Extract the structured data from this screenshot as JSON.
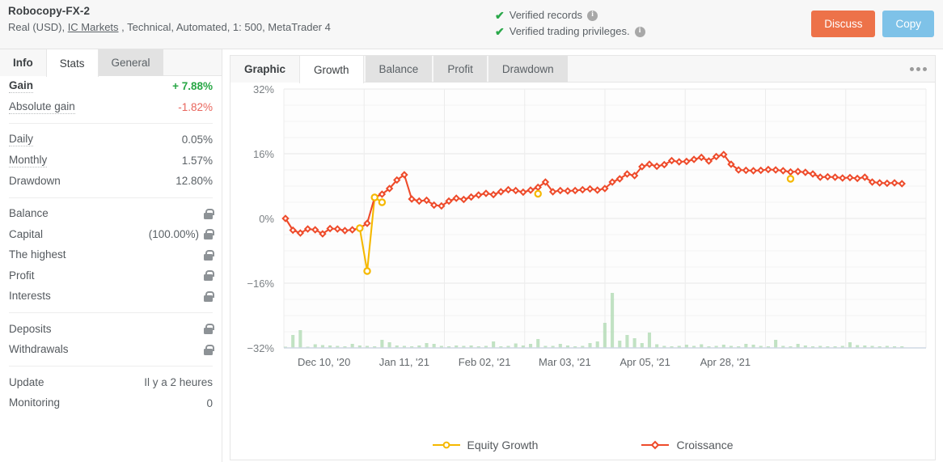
{
  "header": {
    "account_name": "Robocopy-FX-2",
    "account_meta_prefix": "Real (USD), ",
    "broker": "IC Markets",
    "account_meta_suffix": " , Technical, Automated, 1: 500, MetaTrader 4",
    "verified_records": "Verified records",
    "verified_privileges": "Verified trading privileges.",
    "info_glyph": "i",
    "check_glyph": "✔",
    "discuss_label": "Discuss",
    "copy_label": "Copy",
    "discuss_color": "#ed7249",
    "copy_color": "#7ec2e8",
    "check_color": "#2aa84a"
  },
  "sidebar": {
    "tabs": [
      {
        "label": "Info",
        "state": "bold"
      },
      {
        "label": "Stats",
        "state": "active"
      },
      {
        "label": "General",
        "state": "grey"
      }
    ],
    "groups": [
      {
        "rows": [
          {
            "label": "Gain",
            "value": "+ 7.88%",
            "value_color": "green",
            "bold": true,
            "dotted": true,
            "lock": false
          },
          {
            "label": "Absolute gain",
            "value": "-1.82%",
            "value_color": "red",
            "bold": false,
            "dotted": true,
            "lock": false
          }
        ]
      },
      {
        "rows": [
          {
            "label": "Daily",
            "value": "0.05%",
            "value_color": "",
            "bold": false,
            "dotted": true,
            "lock": false
          },
          {
            "label": "Monthly",
            "value": "1.57%",
            "value_color": "",
            "bold": false,
            "dotted": true,
            "lock": false
          },
          {
            "label": "Drawdown",
            "value": "12.80%",
            "value_color": "",
            "bold": false,
            "dotted": false,
            "lock": false
          }
        ]
      },
      {
        "rows": [
          {
            "label": "Balance",
            "value": "",
            "value_color": "",
            "bold": false,
            "dotted": false,
            "lock": true
          },
          {
            "label": "Capital",
            "value": "(100.00%)",
            "value_color": "",
            "bold": false,
            "dotted": false,
            "lock": true
          },
          {
            "label": "The highest",
            "value": "",
            "value_color": "",
            "bold": false,
            "dotted": false,
            "lock": true
          },
          {
            "label": "Profit",
            "value": "",
            "value_color": "",
            "bold": false,
            "dotted": false,
            "lock": true
          },
          {
            "label": "Interests",
            "value": "",
            "value_color": "",
            "bold": false,
            "dotted": false,
            "lock": true
          }
        ]
      },
      {
        "rows": [
          {
            "label": "Deposits",
            "value": "",
            "value_color": "",
            "bold": false,
            "dotted": false,
            "lock": true
          },
          {
            "label": "Withdrawals",
            "value": "",
            "value_color": "",
            "bold": false,
            "dotted": false,
            "lock": true
          }
        ]
      },
      {
        "rows": [
          {
            "label": "Update",
            "value": "Il y a 2 heures",
            "value_color": "",
            "bold": false,
            "dotted": false,
            "lock": false
          },
          {
            "label": "Monitoring",
            "value": "0",
            "value_color": "",
            "bold": false,
            "dotted": false,
            "lock": false
          }
        ]
      }
    ]
  },
  "main": {
    "tabs": [
      {
        "label": "Graphic",
        "state": "bold"
      },
      {
        "label": "Growth",
        "state": "active"
      },
      {
        "label": "Balance",
        "state": "grey"
      },
      {
        "label": "Profit",
        "state": "grey"
      },
      {
        "label": "Drawdown",
        "state": "grey"
      }
    ],
    "menu_icon": "kebab-horizontal-icon"
  },
  "chart_data": {
    "type": "line",
    "title": "",
    "xlabel": "",
    "ylabel": "",
    "ylim": [
      -32,
      32
    ],
    "yticks": [
      32,
      16,
      0,
      -16,
      -32
    ],
    "ytick_labels": [
      "32%",
      "16%",
      "0%",
      "−16%",
      "−32%"
    ],
    "grid": true,
    "minor_grid_step": 4,
    "xtick_labels": [
      "Dec 10, '20",
      "Jan 11, '21",
      "Feb 02, '21",
      "Mar 03, '21",
      "Apr 05, '21",
      "Apr 28, '21"
    ],
    "xtick_positions": [
      0.0,
      0.125,
      0.25,
      0.375,
      0.5,
      0.625
    ],
    "legend_position": "bottom",
    "colors": {
      "croissance": "#ee4b2b",
      "equity": "#f5b800",
      "bars": "#b6ddb9"
    },
    "series": [
      {
        "name": "Croissance",
        "color": "#ee4b2b",
        "marker": "diamond-open",
        "values": [
          0.0,
          -2.9,
          -3.6,
          -2.6,
          -2.8,
          -3.8,
          -2.5,
          -2.6,
          -3.0,
          -2.8,
          -2.4,
          -1.2,
          5.2,
          6.0,
          7.4,
          9.5,
          10.8,
          4.8,
          4.3,
          4.5,
          3.3,
          3.1,
          4.3,
          5.0,
          4.7,
          5.3,
          5.8,
          6.2,
          5.9,
          6.6,
          7.1,
          6.9,
          6.5,
          7.0,
          7.7,
          9.0,
          6.6,
          6.9,
          6.8,
          6.9,
          7.1,
          7.3,
          7.0,
          7.4,
          9.0,
          9.8,
          11.0,
          10.6,
          12.8,
          13.4,
          12.9,
          13.3,
          14.3,
          14.0,
          14.1,
          14.6,
          15.1,
          14.2,
          15.3,
          15.8,
          13.4,
          12.0,
          11.9,
          11.8,
          11.9,
          12.1,
          12.0,
          11.8,
          11.5,
          11.6,
          11.4,
          11.0,
          10.2,
          10.3,
          10.2,
          10.0,
          10.1,
          9.9,
          10.2,
          9.0,
          8.8,
          8.7,
          8.8,
          8.6
        ]
      },
      {
        "name": "Equity Growth",
        "color": "#f5b800",
        "marker": "circle-open",
        "values": [
          null,
          null,
          null,
          null,
          null,
          null,
          null,
          null,
          null,
          null,
          -2.4,
          -13.0,
          5.2,
          4.0,
          null,
          null,
          null,
          null,
          null,
          null,
          null,
          null,
          null,
          null,
          null,
          null,
          null,
          null,
          null,
          null,
          null,
          null,
          null,
          null,
          6.1,
          null,
          null,
          null,
          null,
          null,
          null,
          null,
          null,
          null,
          null,
          null,
          null,
          null,
          null,
          null,
          null,
          null,
          null,
          null,
          null,
          null,
          null,
          null,
          null,
          null,
          null,
          null,
          null,
          null,
          null,
          null,
          null,
          null,
          9.8,
          null,
          null,
          null,
          null,
          null,
          null,
          null,
          null,
          null,
          null,
          null,
          null,
          null,
          null,
          null
        ]
      },
      {
        "name": "Trade volume bars",
        "type": "bar",
        "color": "#b6ddb9",
        "baseline": -32,
        "values": [
          0.3,
          3.2,
          4.4,
          0.3,
          0.9,
          0.7,
          0.6,
          0.5,
          0.4,
          1.0,
          0.6,
          0.5,
          0.4,
          2.0,
          1.4,
          0.6,
          0.5,
          0.4,
          0.6,
          1.2,
          1.0,
          0.5,
          0.4,
          0.6,
          0.5,
          0.6,
          0.4,
          0.5,
          1.6,
          0.4,
          0.5,
          1.1,
          0.6,
          1.0,
          2.2,
          0.5,
          0.5,
          1.0,
          0.6,
          0.4,
          0.5,
          1.2,
          1.6,
          6.2,
          13.6,
          1.8,
          3.2,
          2.4,
          1.2,
          3.8,
          0.9,
          0.5,
          0.4,
          0.5,
          0.8,
          0.5,
          0.9,
          0.4,
          0.5,
          0.8,
          0.5,
          0.4,
          1.0,
          0.8,
          0.5,
          0.4,
          2.0,
          0.5,
          0.4,
          1.0,
          0.6,
          0.4,
          0.5,
          0.4,
          0.4,
          0.5,
          1.4,
          0.7,
          0.6,
          0.5,
          0.4,
          0.5,
          0.4,
          0.4
        ]
      }
    ]
  }
}
